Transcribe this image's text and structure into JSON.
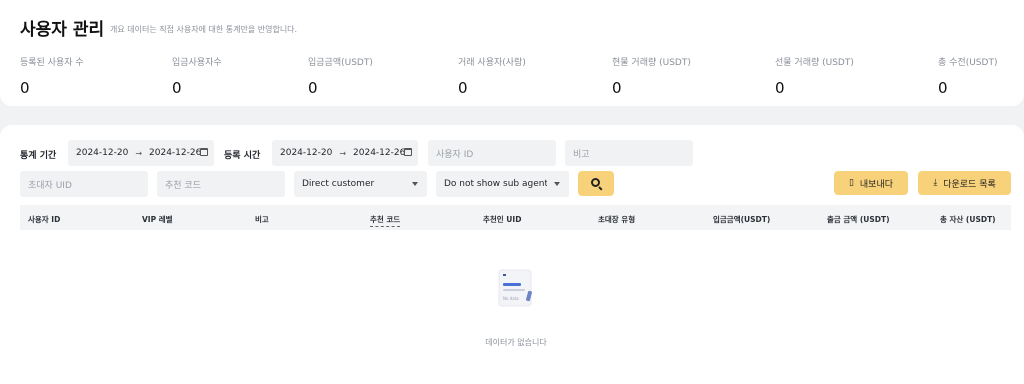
{
  "header": {
    "title": "사용자 관리",
    "description": "개요 데이터는 직접 사용자에 대한 통계만을 반영합니다."
  },
  "stats": [
    {
      "label": "등록된 사용자 수",
      "value": "0"
    },
    {
      "label": "입금사용자수",
      "value": "0"
    },
    {
      "label": "입금금액(USDT)",
      "value": "0"
    },
    {
      "label": "거래 사용자(사람)",
      "value": "0"
    },
    {
      "label": "현물 거래량 (USDT)",
      "value": "0"
    },
    {
      "label": "선물 거래량 (USDT)",
      "value": "0"
    },
    {
      "label": "총 수전(USDT)",
      "value": "0"
    }
  ],
  "filters": {
    "stat_period_label": "통계 기간",
    "stat_start": "2024-12-20",
    "stat_end": "2024-12-26",
    "reg_time_label": "등록 시간",
    "reg_start": "2024-12-20",
    "reg_end": "2024-12-26",
    "arrow": "→",
    "user_id_placeholder": "사용자 ID",
    "note_placeholder": "비고",
    "inviter_uid_placeholder": "초대자 UID",
    "referral_code_placeholder": "추천 코드",
    "customer_type_value": "Direct customer",
    "sub_agent_value": "Do not show sub agent in"
  },
  "actions": {
    "export_label": "내보내다",
    "download_list_label": "다운로드 목록"
  },
  "table": {
    "columns": [
      "사용자 ID",
      "VIP 레벨",
      "비고",
      "추천 코드",
      "추천인 UID",
      "초대장 유형",
      "입금금액(USDT)",
      "출금 금액 (USDT)",
      "총 자산 (USDT)"
    ],
    "rows": []
  },
  "empty_state": {
    "message": "데이터가 없습니다",
    "illustration_text": "No data"
  },
  "colors": {
    "accent": "#f7d27b",
    "background": "#f1f2f4",
    "card": "#ffffff"
  }
}
